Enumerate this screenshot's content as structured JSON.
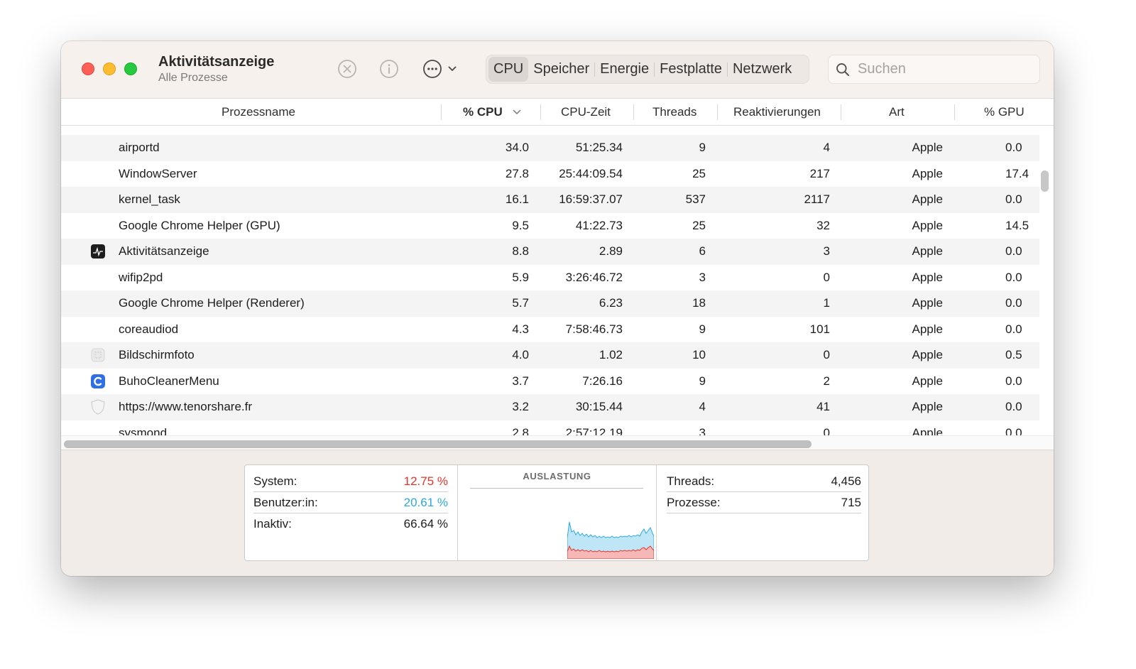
{
  "window": {
    "title": "Aktivitätsanzeige",
    "subtitle": "Alle Prozesse"
  },
  "toolbar": {
    "stop_icon": "stop-process-icon",
    "info_icon": "info-icon",
    "more_icon": "ellipsis-icon",
    "tabs": [
      "CPU",
      "Speicher",
      "Energie",
      "Festplatte",
      "Netzwerk"
    ],
    "active_tab": "CPU",
    "search_placeholder": "Suchen"
  },
  "table": {
    "columns": [
      "Prozessname",
      "% CPU",
      "CPU-Zeit",
      "Threads",
      "Reaktivierungen",
      "Art",
      "% GPU"
    ],
    "sorted_column": "% CPU",
    "rows": [
      {
        "name": "airportd",
        "cpu": "34.0",
        "time": "51:25.34",
        "threads": "9",
        "wakeups": "4",
        "kind": "Apple",
        "gpu": "0.0",
        "icon": ""
      },
      {
        "name": "WindowServer",
        "cpu": "27.8",
        "time": "25:44:09.54",
        "threads": "25",
        "wakeups": "217",
        "kind": "Apple",
        "gpu": "17.4",
        "icon": ""
      },
      {
        "name": "kernel_task",
        "cpu": "16.1",
        "time": "16:59:37.07",
        "threads": "537",
        "wakeups": "2117",
        "kind": "Apple",
        "gpu": "0.0",
        "icon": ""
      },
      {
        "name": "Google Chrome Helper (GPU)",
        "cpu": "9.5",
        "time": "41:22.73",
        "threads": "25",
        "wakeups": "32",
        "kind": "Apple",
        "gpu": "14.5",
        "icon": ""
      },
      {
        "name": "Aktivitätsanzeige",
        "cpu": "8.8",
        "time": "2.89",
        "threads": "6",
        "wakeups": "3",
        "kind": "Apple",
        "gpu": "0.0",
        "icon": "activity-monitor-icon"
      },
      {
        "name": "wifip2pd",
        "cpu": "5.9",
        "time": "3:26:46.72",
        "threads": "3",
        "wakeups": "0",
        "kind": "Apple",
        "gpu": "0.0",
        "icon": ""
      },
      {
        "name": "Google Chrome Helper (Renderer)",
        "cpu": "5.7",
        "time": "6.23",
        "threads": "18",
        "wakeups": "1",
        "kind": "Apple",
        "gpu": "0.0",
        "icon": ""
      },
      {
        "name": "coreaudiod",
        "cpu": "4.3",
        "time": "7:58:46.73",
        "threads": "9",
        "wakeups": "101",
        "kind": "Apple",
        "gpu": "0.0",
        "icon": ""
      },
      {
        "name": "Bildschirmfoto",
        "cpu": "4.0",
        "time": "1.02",
        "threads": "10",
        "wakeups": "0",
        "kind": "Apple",
        "gpu": "0.5",
        "icon": "screenshot-icon"
      },
      {
        "name": "BuhoCleanerMenu",
        "cpu": "3.7",
        "time": "7:26.16",
        "threads": "9",
        "wakeups": "2",
        "kind": "Apple",
        "gpu": "0.0",
        "icon": "buhocleaner-icon"
      },
      {
        "name": "https://www.tenorshare.fr",
        "cpu": "3.2",
        "time": "30:15.44",
        "threads": "4",
        "wakeups": "41",
        "kind": "Apple",
        "gpu": "0.0",
        "icon": "shield-icon"
      },
      {
        "name": "sysmond",
        "cpu": "2.8",
        "time": "2:57:12.19",
        "threads": "3",
        "wakeups": "0",
        "kind": "Apple",
        "gpu": "0.0",
        "icon": ""
      }
    ]
  },
  "summary": {
    "system_label": "System:",
    "system_value": "12.75 %",
    "user_label": "Benutzer:in:",
    "user_value": "20.61 %",
    "idle_label": "Inaktiv:",
    "idle_value": "66.64 %",
    "graph_title": "AUSLASTUNG",
    "threads_label": "Threads:",
    "threads_value": "4,456",
    "processes_label": "Prozesse:",
    "processes_value": "715"
  },
  "colors": {
    "system": "#e6332a",
    "user": "#2ea8e0",
    "close": "#fe5f57",
    "minimize": "#febc2e",
    "zoom": "#28c840"
  }
}
